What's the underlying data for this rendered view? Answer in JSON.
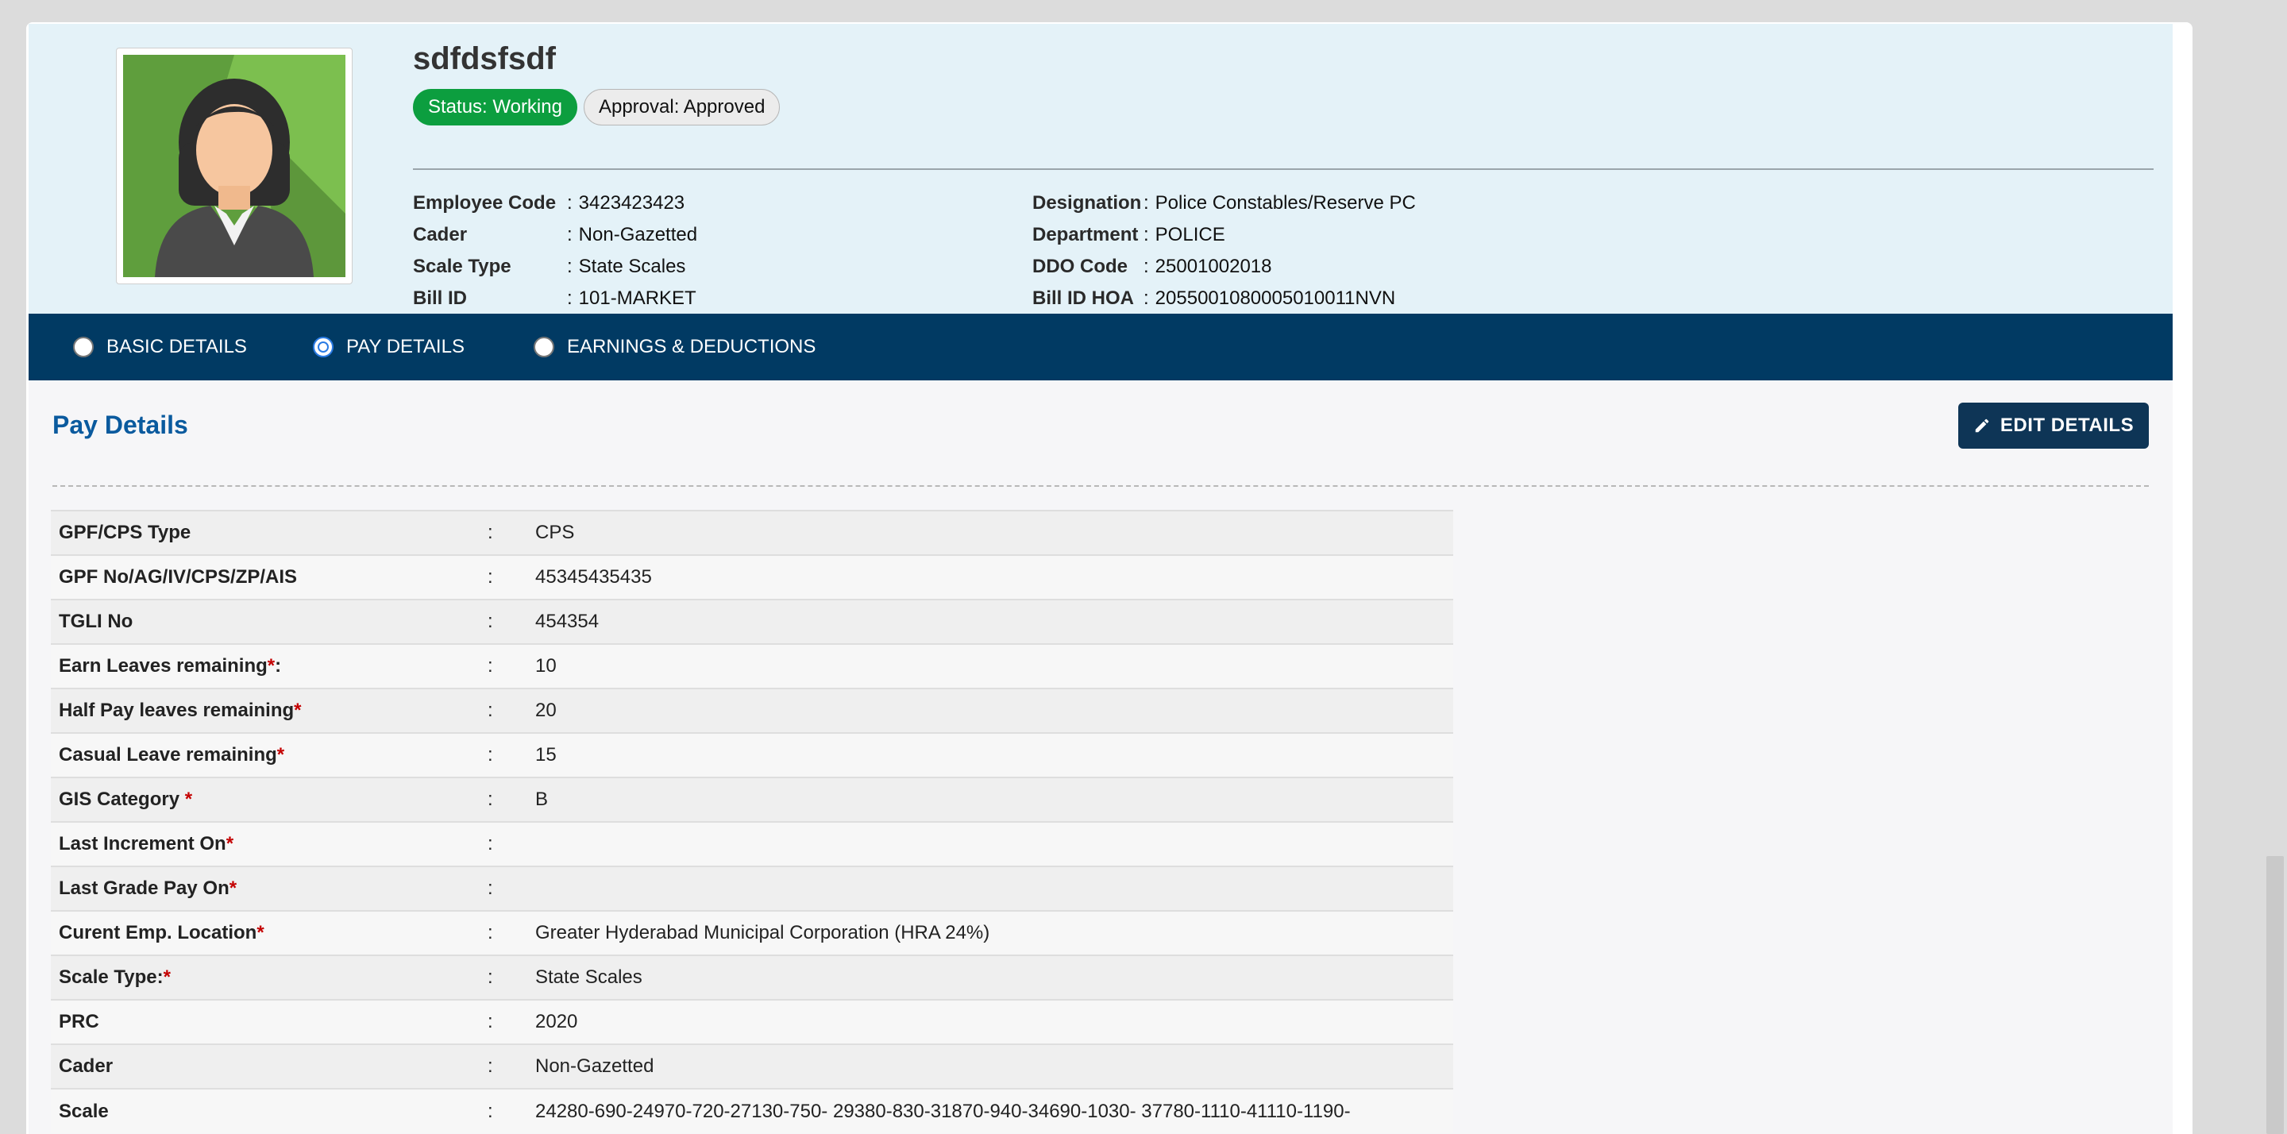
{
  "employee": {
    "name": "sdfdsfsdf",
    "status_badge": "Status: Working",
    "approval_badge": "Approval: Approved",
    "left_info": [
      {
        "label": "Employee Code",
        "value": "3423423423"
      },
      {
        "label": "Cader",
        "value": "Non-Gazetted"
      },
      {
        "label": "Scale Type",
        "value": "State Scales"
      },
      {
        "label": "Bill ID",
        "value": "101-MARKET"
      }
    ],
    "right_info": [
      {
        "label": "Designation",
        "value": "Police Constables/Reserve PC"
      },
      {
        "label": "Department",
        "value": "POLICE"
      },
      {
        "label": "DDO Code",
        "value": "25001002018"
      },
      {
        "label": "Bill ID HOA",
        "value": "2055001080005010011NVN"
      }
    ],
    "separator": ":"
  },
  "tabs": [
    {
      "label": "BASIC DETAILS",
      "selected": false
    },
    {
      "label": "PAY DETAILS",
      "selected": true
    },
    {
      "label": "EARNINGS & DEDUCTIONS",
      "selected": false
    }
  ],
  "pay_details": {
    "title": "Pay Details",
    "edit_button": "EDIT DETAILS",
    "separator": ":",
    "rows": [
      {
        "label": "GPF/CPS Type",
        "required": "",
        "suffix": "",
        "value": "CPS"
      },
      {
        "label": "GPF No/AG/IV/CPS/ZP/AIS",
        "required": "",
        "suffix": "",
        "value": "45345435435"
      },
      {
        "label": "TGLI No",
        "required": "",
        "suffix": "",
        "value": "454354"
      },
      {
        "label": "Earn Leaves remaining",
        "required": "*",
        "suffix": ":",
        "value": "10"
      },
      {
        "label": "Half Pay leaves remaining",
        "required": "*",
        "suffix": "",
        "value": "20"
      },
      {
        "label": "Casual Leave remaining",
        "required": "*",
        "suffix": "",
        "value": "15"
      },
      {
        "label": "GIS Category ",
        "required": "*",
        "suffix": "",
        "value": "B"
      },
      {
        "label": "Last Increment On",
        "required": "*",
        "suffix": "",
        "value": ""
      },
      {
        "label": "Last Grade Pay On",
        "required": "*",
        "suffix": "",
        "value": ""
      },
      {
        "label": "Curent Emp. Location",
        "required": "*",
        "suffix": "",
        "value": "Greater Hyderabad Municipal Corporation (HRA 24%)"
      },
      {
        "label": "Scale Type:",
        "required": "*",
        "suffix": "",
        "value": "State Scales"
      },
      {
        "label": "PRC",
        "required": "",
        "suffix": "",
        "value": "2020"
      },
      {
        "label": "Cader",
        "required": "",
        "suffix": "",
        "value": "Non-Gazetted"
      },
      {
        "label": "Scale",
        "required": "",
        "suffix": "",
        "value": "24280-690-24970-720-27130-750- 29380-830-31870-940-34690-1030- 37780-1110-41110-1190-"
      }
    ]
  }
}
